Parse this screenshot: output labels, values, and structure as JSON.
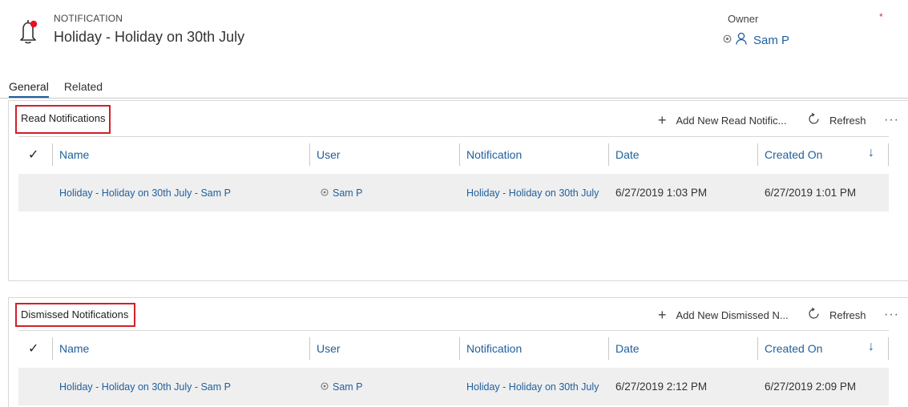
{
  "header": {
    "entity_type": "NOTIFICATION",
    "title": "Holiday - Holiday on 30th July",
    "owner_label": "Owner",
    "required_marker": "*",
    "owner_name": "Sam P"
  },
  "tabs": [
    {
      "label": "General",
      "active": true
    },
    {
      "label": "Related",
      "active": false
    }
  ],
  "colors": {
    "accent": "#1f5f9c",
    "highlight_box": "#d0202a",
    "row_bg": "#efefef"
  },
  "columns": [
    "Name",
    "User",
    "Notification",
    "Date",
    "Created On"
  ],
  "read_section": {
    "title": "Read Notifications",
    "add_label": "Add New Read Notific...",
    "refresh_label": "Refresh",
    "more_label": "···",
    "rows": [
      {
        "name": "Holiday - Holiday on 30th July - Sam P",
        "user": "Sam P",
        "notification": "Holiday - Holiday on 30th July",
        "date": "6/27/2019 1:03 PM",
        "created_on": "6/27/2019 1:01 PM"
      }
    ]
  },
  "dismissed_section": {
    "title": "Dismissed Notifications",
    "add_label": "Add New Dismissed N...",
    "refresh_label": "Refresh",
    "more_label": "···",
    "rows": [
      {
        "name": "Holiday - Holiday on 30th July - Sam P",
        "user": "Sam P",
        "notification": "Holiday - Holiday on 30th July",
        "date": "6/27/2019 2:12 PM",
        "created_on": "6/27/2019 2:09 PM"
      }
    ]
  }
}
